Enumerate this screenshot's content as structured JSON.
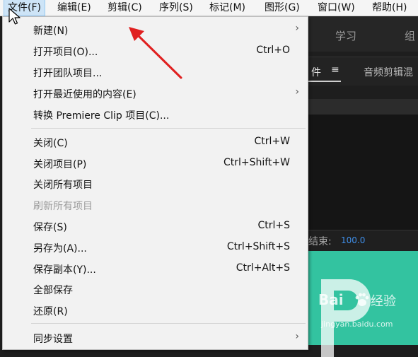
{
  "menubar": {
    "items": [
      {
        "label": "文件(F)",
        "active": true
      },
      {
        "label": "编辑(E)"
      },
      {
        "label": "剪辑(C)"
      },
      {
        "label": "序列(S)"
      },
      {
        "label": "标记(M)"
      },
      {
        "label": "图形(G)"
      },
      {
        "label": "窗口(W)"
      },
      {
        "label": "帮助(H)"
      }
    ]
  },
  "background": {
    "tabs": [
      "学习",
      "组"
    ],
    "panel_tabs": [
      "件",
      "音频剪辑混"
    ],
    "end_label": "结束:",
    "end_value": "100.0"
  },
  "file_menu": {
    "items": [
      {
        "label": "新建(N)",
        "shortcut": "",
        "submenu": true
      },
      {
        "label": "打开项目(O)...",
        "shortcut": "Ctrl+O"
      },
      {
        "label": "打开团队项目...",
        "shortcut": ""
      },
      {
        "label": "打开最近使用的内容(E)",
        "shortcut": "",
        "submenu": true
      },
      {
        "label": "转换 Premiere Clip 项目(C)...",
        "shortcut": ""
      },
      {
        "label": "关闭(C)",
        "shortcut": "Ctrl+W"
      },
      {
        "label": "关闭项目(P)",
        "shortcut": "Ctrl+Shift+W"
      },
      {
        "label": "关闭所有项目",
        "shortcut": ""
      },
      {
        "label": "刷新所有项目",
        "shortcut": "",
        "disabled": true
      },
      {
        "label": "保存(S)",
        "shortcut": "Ctrl+S"
      },
      {
        "label": "另存为(A)...",
        "shortcut": "Ctrl+Shift+S"
      },
      {
        "label": "保存副本(Y)...",
        "shortcut": "Ctrl+Alt+S"
      },
      {
        "label": "全部保存",
        "shortcut": ""
      },
      {
        "label": "还原(R)",
        "shortcut": ""
      },
      {
        "label": "同步设置",
        "shortcut": "",
        "submenu": true
      }
    ],
    "submenu_arrow": "›"
  },
  "watermark": {
    "brand": "Bai",
    "brand_cn": "经验",
    "url": "jingyan.baidu.com"
  },
  "colors": {
    "menu_bg": "#f2f2f2",
    "highlight": "#cde4f7",
    "arrow_red": "#e02020",
    "green_panel": "#33c3a0",
    "link_blue": "#3f8ee8"
  }
}
